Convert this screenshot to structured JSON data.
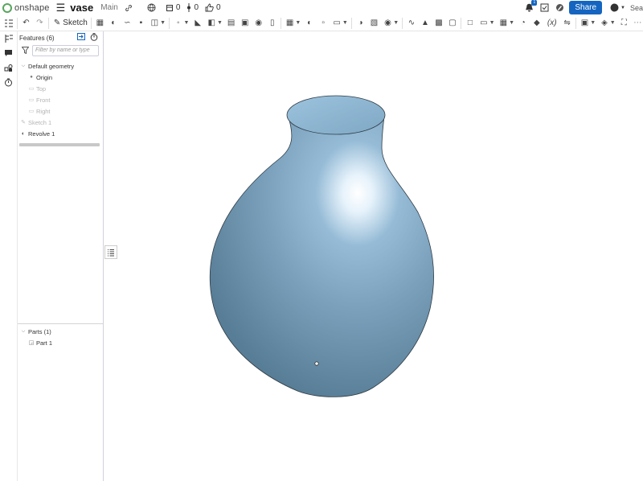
{
  "app": {
    "logo_text": "onshape"
  },
  "document": {
    "title": "vase",
    "branch": "Main"
  },
  "counts": {
    "versions": "0",
    "branches": "0",
    "likes": "0"
  },
  "actions": {
    "share_label": "Share",
    "search_stub": "Sea",
    "notification_badge": "1",
    "help_label": "?"
  },
  "toolbar": {
    "sketch_label": "Sketch"
  },
  "panel": {
    "features_header": "Features (6)",
    "filter_placeholder": "Filter by name or type",
    "default_geometry_label": "Default geometry",
    "origin_label": "Origin",
    "top_label": "Top",
    "front_label": "Front",
    "right_label": "Right",
    "sketch_label": "Sketch 1",
    "revolve_label": "Revolve 1",
    "parts_header": "Parts (1)",
    "part_label": "Part 1"
  },
  "colors": {
    "accent": "#1565c0",
    "logo": "#58a65c",
    "part_fill": "#7fa8c4"
  }
}
